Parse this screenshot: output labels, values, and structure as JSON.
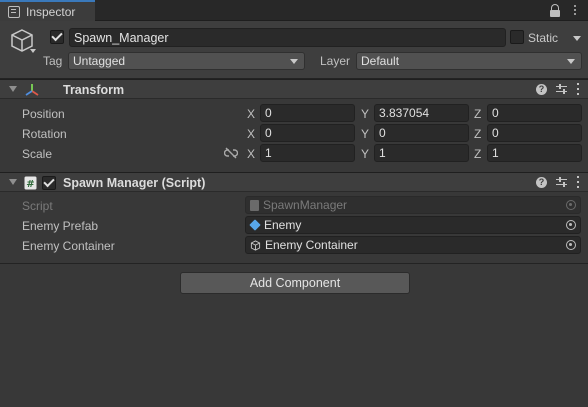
{
  "tab": {
    "title": "Inspector"
  },
  "header": {
    "object_name": "Spawn_Manager",
    "active": true,
    "static_label": "Static",
    "static_checked": false,
    "tag_label": "Tag",
    "tag_value": "Untagged",
    "layer_label": "Layer",
    "layer_value": "Default"
  },
  "transform": {
    "title": "Transform",
    "rows": [
      {
        "label": "Position",
        "x": "0",
        "y": "3.837054",
        "z": "0"
      },
      {
        "label": "Rotation",
        "x": "0",
        "y": "0",
        "z": "0"
      },
      {
        "label": "Scale",
        "x": "1",
        "y": "1",
        "z": "1"
      }
    ],
    "axes": {
      "x": "X",
      "y": "Y",
      "z": "Z"
    }
  },
  "spawn_manager": {
    "title": "Spawn Manager (Script)",
    "enabled": true,
    "fields": [
      {
        "label": "Script",
        "value": "SpawnManager",
        "icon": "script-file-icon"
      },
      {
        "label": "Enemy Prefab",
        "value": "Enemy",
        "icon": "prefab-icon"
      },
      {
        "label": "Enemy Container",
        "value": "Enemy Container",
        "icon": "gameobject-icon"
      }
    ]
  },
  "add_component": {
    "label": "Add Component"
  },
  "colors": {
    "accent": "#3a79bb",
    "prefab": "#58a6e8",
    "background": "#383838"
  },
  "header_icons": {
    "help": "?"
  }
}
